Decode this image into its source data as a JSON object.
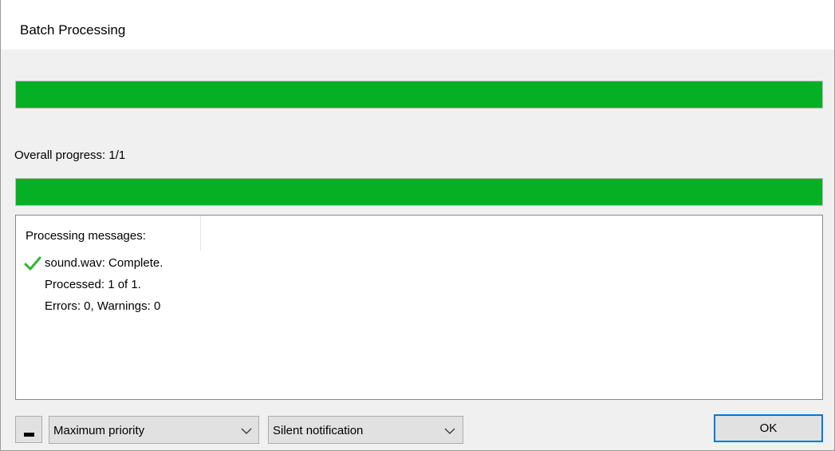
{
  "window": {
    "title": "Batch Processing"
  },
  "progress": {
    "current_file_fraction": 1.0,
    "overall_fraction": 1.0,
    "overall_label": "Overall progress:  1/1"
  },
  "messages": {
    "header": "Processing messages:",
    "lines": [
      {
        "icon": "check-icon",
        "text": "sound.wav: Complete."
      },
      {
        "icon": "",
        "text": "Processed: 1 of 1."
      },
      {
        "icon": "",
        "text": "Errors: 0,  Warnings: 0"
      }
    ]
  },
  "footer": {
    "collapse_icon": "minus-icon",
    "priority_selected": "Maximum priority",
    "notification_selected": "Silent notification",
    "ok_label": "OK"
  },
  "colors": {
    "progress_fill": "#06b025",
    "check_icon": "#2fb52f",
    "ok_focus_border": "#0078d7"
  }
}
